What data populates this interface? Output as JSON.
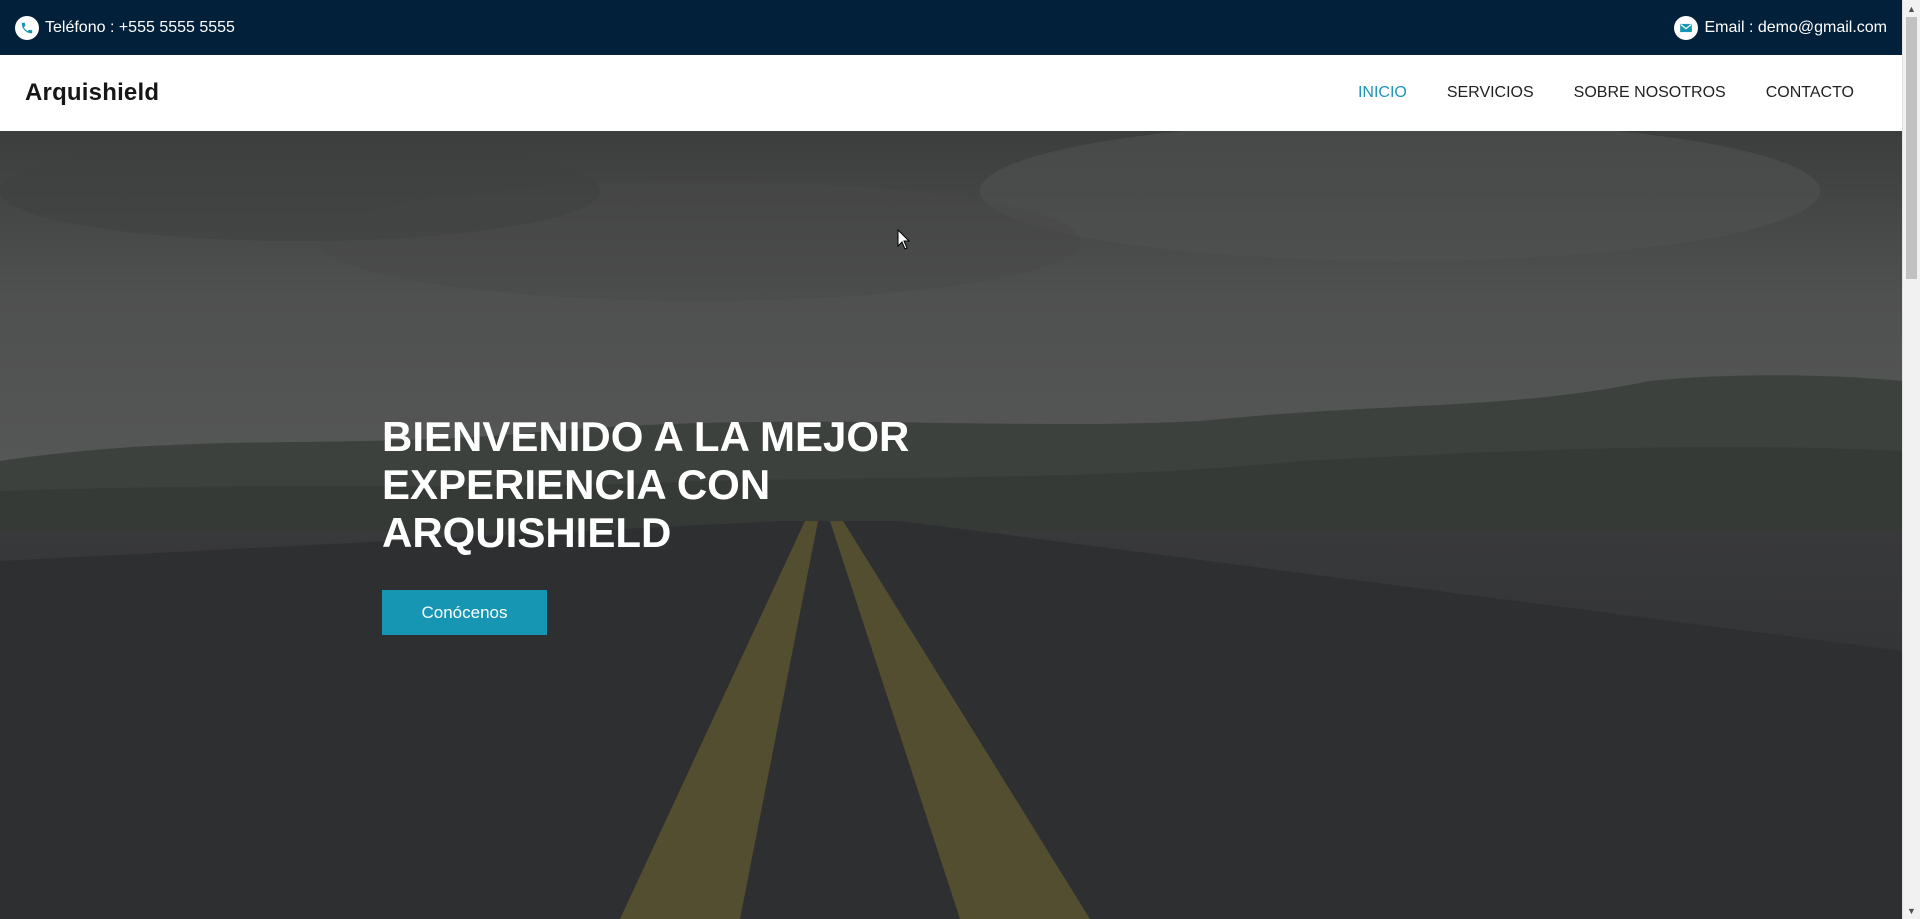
{
  "topbar": {
    "phone_text": "Teléfono : +555 5555 5555",
    "email_text": "Email : demo@gmail.com",
    "phone_icon": "phone-icon",
    "email_icon": "envelope-icon",
    "background_color": "#03203a"
  },
  "navbar": {
    "brand": "Arquishield",
    "menu": [
      {
        "label": "INICIO",
        "active": true
      },
      {
        "label": "SERVICIOS",
        "active": false
      },
      {
        "label": "SOBRE NOSOTROS",
        "active": false
      },
      {
        "label": "CONTACTO",
        "active": false
      }
    ],
    "active_color": "#1b97b5"
  },
  "hero": {
    "title": "BIENVENIDO A LA MEJOR EXPERIENCIA CON ARQUISHIELD",
    "button_label": "Conócenos",
    "button_color": "#1796b3"
  }
}
